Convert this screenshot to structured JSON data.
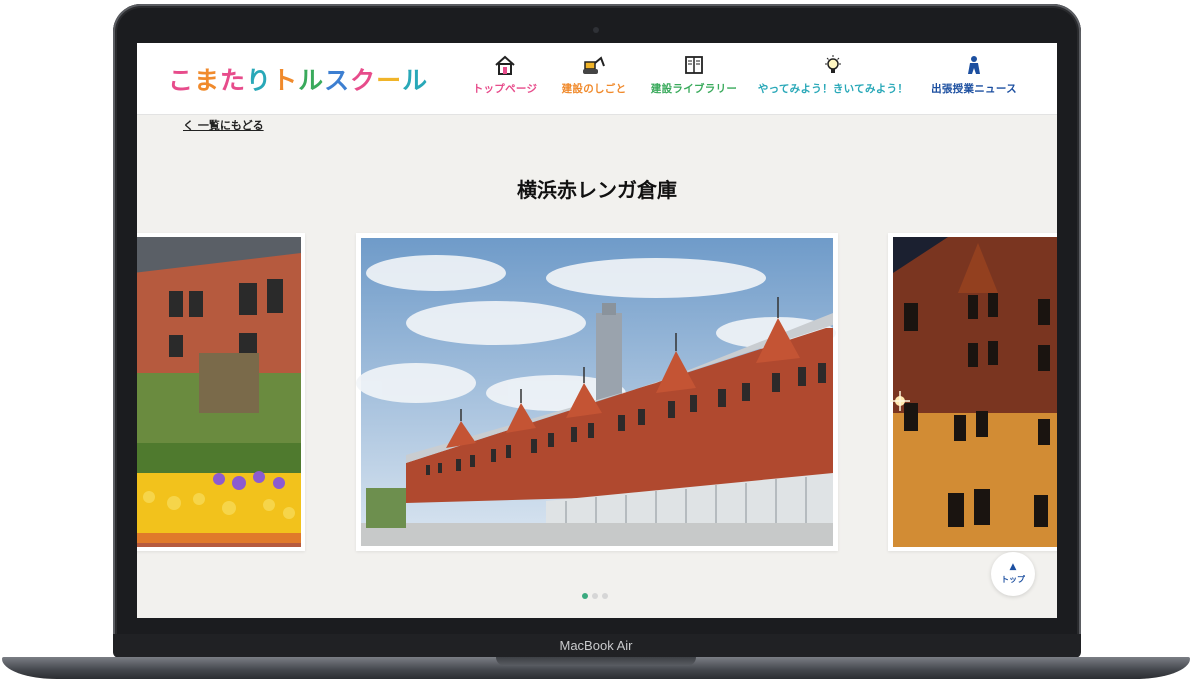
{
  "device": {
    "label": "MacBook Air"
  },
  "site": {
    "logo": {
      "chars": [
        "こ",
        "ま",
        "た",
        "り",
        "ト",
        "ル",
        "ス",
        "ク",
        "ー",
        "ル"
      ],
      "colors": [
        "#e74c8b",
        "#f08a2c",
        "#e74c8b",
        "#29a8b8",
        "#f08a2c",
        "#3aaa5c",
        "#3d7fd1",
        "#e74c8b",
        "#f0b429",
        "#29a8b8"
      ]
    },
    "nav": [
      {
        "label": "トップページ",
        "icon": "house-icon",
        "color": "#e74c8b"
      },
      {
        "label": "建設のしごと",
        "icon": "excavator-icon",
        "color": "#f08a2c"
      },
      {
        "label": "建設ライブラリー",
        "icon": "book-icon",
        "color": "#3aaa5c"
      },
      {
        "label": "やってみよう！きいてみよう！",
        "icon": "lightbulb-icon",
        "color": "#29a8b8"
      },
      {
        "label": "出張授業ニュース",
        "icon": "person-icon",
        "color": "#1c4fa0"
      }
    ]
  },
  "page": {
    "back_link": "く 一覧にもどる",
    "title": "横浜赤レンガ倉庫",
    "carousel": {
      "total": 3,
      "active": 0
    },
    "to_top_label": "トップ"
  }
}
